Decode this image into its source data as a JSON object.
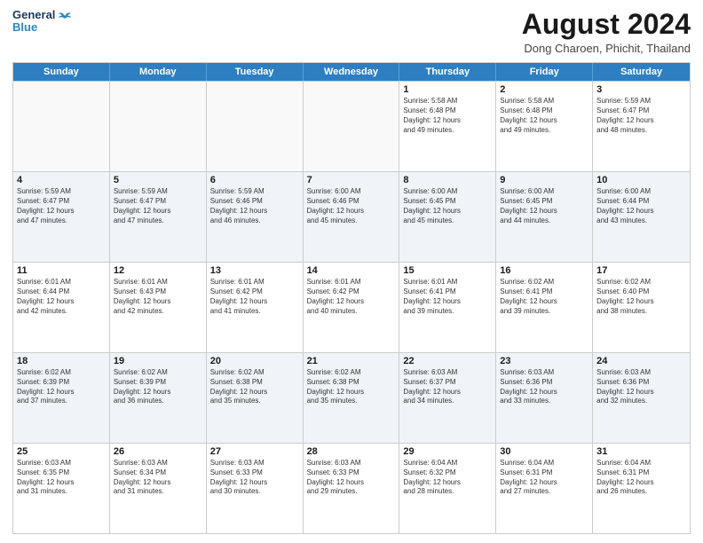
{
  "header": {
    "logo_line1": "General",
    "logo_line2": "Blue",
    "month_year": "August 2024",
    "location": "Dong Charoen, Phichit, Thailand"
  },
  "weekdays": [
    "Sunday",
    "Monday",
    "Tuesday",
    "Wednesday",
    "Thursday",
    "Friday",
    "Saturday"
  ],
  "rows": [
    [
      {
        "day": "",
        "info": "",
        "empty": true
      },
      {
        "day": "",
        "info": "",
        "empty": true
      },
      {
        "day": "",
        "info": "",
        "empty": true
      },
      {
        "day": "",
        "info": "",
        "empty": true
      },
      {
        "day": "1",
        "info": "Sunrise: 5:58 AM\nSunset: 6:48 PM\nDaylight: 12 hours\nand 49 minutes.",
        "empty": false
      },
      {
        "day": "2",
        "info": "Sunrise: 5:58 AM\nSunset: 6:48 PM\nDaylight: 12 hours\nand 49 minutes.",
        "empty": false
      },
      {
        "day": "3",
        "info": "Sunrise: 5:59 AM\nSunset: 6:47 PM\nDaylight: 12 hours\nand 48 minutes.",
        "empty": false
      }
    ],
    [
      {
        "day": "4",
        "info": "Sunrise: 5:59 AM\nSunset: 6:47 PM\nDaylight: 12 hours\nand 47 minutes.",
        "empty": false
      },
      {
        "day": "5",
        "info": "Sunrise: 5:59 AM\nSunset: 6:47 PM\nDaylight: 12 hours\nand 47 minutes.",
        "empty": false
      },
      {
        "day": "6",
        "info": "Sunrise: 5:59 AM\nSunset: 6:46 PM\nDaylight: 12 hours\nand 46 minutes.",
        "empty": false
      },
      {
        "day": "7",
        "info": "Sunrise: 6:00 AM\nSunset: 6:46 PM\nDaylight: 12 hours\nand 45 minutes.",
        "empty": false
      },
      {
        "day": "8",
        "info": "Sunrise: 6:00 AM\nSunset: 6:45 PM\nDaylight: 12 hours\nand 45 minutes.",
        "empty": false
      },
      {
        "day": "9",
        "info": "Sunrise: 6:00 AM\nSunset: 6:45 PM\nDaylight: 12 hours\nand 44 minutes.",
        "empty": false
      },
      {
        "day": "10",
        "info": "Sunrise: 6:00 AM\nSunset: 6:44 PM\nDaylight: 12 hours\nand 43 minutes.",
        "empty": false
      }
    ],
    [
      {
        "day": "11",
        "info": "Sunrise: 6:01 AM\nSunset: 6:44 PM\nDaylight: 12 hours\nand 42 minutes.",
        "empty": false
      },
      {
        "day": "12",
        "info": "Sunrise: 6:01 AM\nSunset: 6:43 PM\nDaylight: 12 hours\nand 42 minutes.",
        "empty": false
      },
      {
        "day": "13",
        "info": "Sunrise: 6:01 AM\nSunset: 6:42 PM\nDaylight: 12 hours\nand 41 minutes.",
        "empty": false
      },
      {
        "day": "14",
        "info": "Sunrise: 6:01 AM\nSunset: 6:42 PM\nDaylight: 12 hours\nand 40 minutes.",
        "empty": false
      },
      {
        "day": "15",
        "info": "Sunrise: 6:01 AM\nSunset: 6:41 PM\nDaylight: 12 hours\nand 39 minutes.",
        "empty": false
      },
      {
        "day": "16",
        "info": "Sunrise: 6:02 AM\nSunset: 6:41 PM\nDaylight: 12 hours\nand 39 minutes.",
        "empty": false
      },
      {
        "day": "17",
        "info": "Sunrise: 6:02 AM\nSunset: 6:40 PM\nDaylight: 12 hours\nand 38 minutes.",
        "empty": false
      }
    ],
    [
      {
        "day": "18",
        "info": "Sunrise: 6:02 AM\nSunset: 6:39 PM\nDaylight: 12 hours\nand 37 minutes.",
        "empty": false
      },
      {
        "day": "19",
        "info": "Sunrise: 6:02 AM\nSunset: 6:39 PM\nDaylight: 12 hours\nand 36 minutes.",
        "empty": false
      },
      {
        "day": "20",
        "info": "Sunrise: 6:02 AM\nSunset: 6:38 PM\nDaylight: 12 hours\nand 35 minutes.",
        "empty": false
      },
      {
        "day": "21",
        "info": "Sunrise: 6:02 AM\nSunset: 6:38 PM\nDaylight: 12 hours\nand 35 minutes.",
        "empty": false
      },
      {
        "day": "22",
        "info": "Sunrise: 6:03 AM\nSunset: 6:37 PM\nDaylight: 12 hours\nand 34 minutes.",
        "empty": false
      },
      {
        "day": "23",
        "info": "Sunrise: 6:03 AM\nSunset: 6:36 PM\nDaylight: 12 hours\nand 33 minutes.",
        "empty": false
      },
      {
        "day": "24",
        "info": "Sunrise: 6:03 AM\nSunset: 6:36 PM\nDaylight: 12 hours\nand 32 minutes.",
        "empty": false
      }
    ],
    [
      {
        "day": "25",
        "info": "Sunrise: 6:03 AM\nSunset: 6:35 PM\nDaylight: 12 hours\nand 31 minutes.",
        "empty": false
      },
      {
        "day": "26",
        "info": "Sunrise: 6:03 AM\nSunset: 6:34 PM\nDaylight: 12 hours\nand 31 minutes.",
        "empty": false
      },
      {
        "day": "27",
        "info": "Sunrise: 6:03 AM\nSunset: 6:33 PM\nDaylight: 12 hours\nand 30 minutes.",
        "empty": false
      },
      {
        "day": "28",
        "info": "Sunrise: 6:03 AM\nSunset: 6:33 PM\nDaylight: 12 hours\nand 29 minutes.",
        "empty": false
      },
      {
        "day": "29",
        "info": "Sunrise: 6:04 AM\nSunset: 6:32 PM\nDaylight: 12 hours\nand 28 minutes.",
        "empty": false
      },
      {
        "day": "30",
        "info": "Sunrise: 6:04 AM\nSunset: 6:31 PM\nDaylight: 12 hours\nand 27 minutes.",
        "empty": false
      },
      {
        "day": "31",
        "info": "Sunrise: 6:04 AM\nSunset: 6:31 PM\nDaylight: 12 hours\nand 26 minutes.",
        "empty": false
      }
    ]
  ]
}
